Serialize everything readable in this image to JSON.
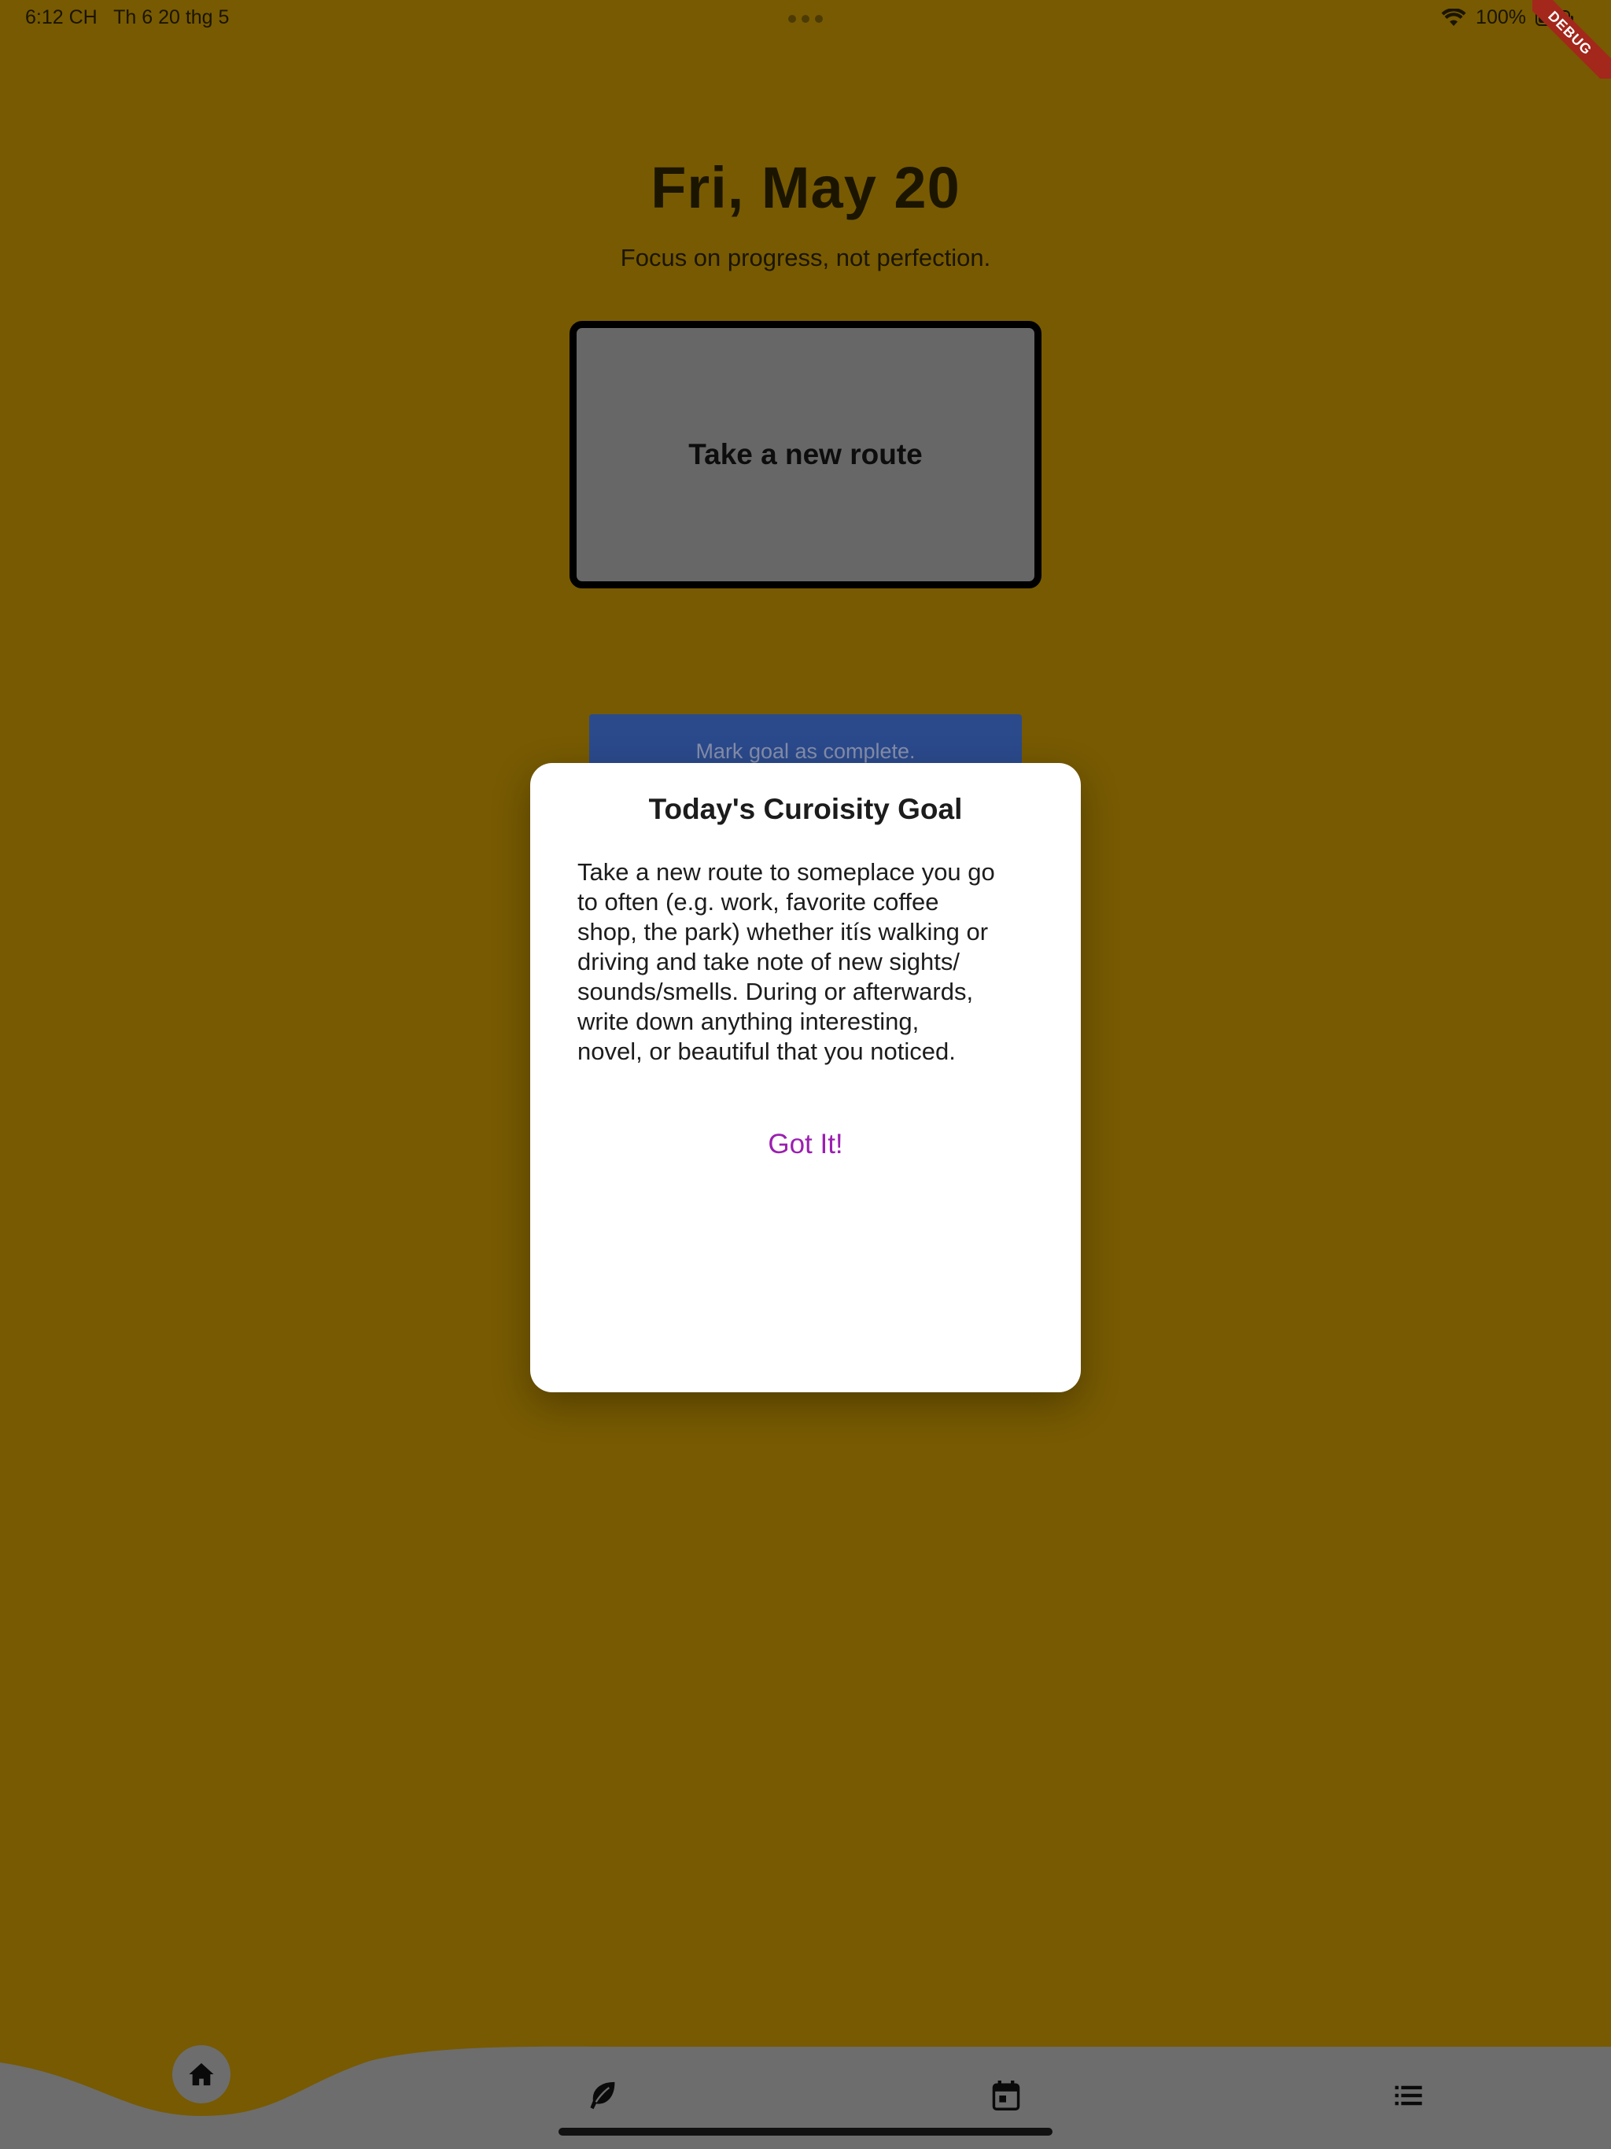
{
  "status_bar": {
    "time": "6:12 CH",
    "date": "Th 6 20 thg 5",
    "battery": "100%"
  },
  "debug_banner": "DEBUG",
  "header": {
    "date": "Fri, May 20",
    "subtitle": "Focus on progress, not perfection."
  },
  "goal_card": {
    "title": "Take a new route"
  },
  "complete_button": {
    "label": "Mark goal as complete."
  },
  "dialog": {
    "title": "Today's Curoisity Goal",
    "body": "Take a new route to someplace you go\nto often (e.g. work, favorite coffee\nshop, the park) whether itís walking or\ndriving and take note of new sights/\nsounds/smells. During or afterwards,\nwrite down anything interesting,\nnovel, or beautiful that you noticed.",
    "button": "Got It!"
  },
  "bottom_nav": {
    "items": [
      {
        "icon": "home-icon",
        "selected": true
      },
      {
        "icon": "leaf-icon",
        "selected": false
      },
      {
        "icon": "calendar-icon",
        "selected": false
      },
      {
        "icon": "list-icon",
        "selected": false
      }
    ]
  },
  "colors": {
    "background": "#775a02",
    "nav_bar": "#6d6d6d",
    "card": "#676767",
    "button": "#2b4a8c",
    "dialog_action": "#9b1fb0"
  }
}
